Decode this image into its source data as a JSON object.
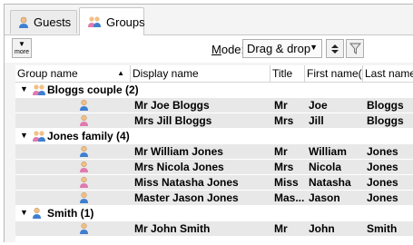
{
  "tabs": [
    {
      "label": "Guests",
      "icon": "person-icon",
      "active": false
    },
    {
      "label": "Groups",
      "icon": "group-icon",
      "active": true
    }
  ],
  "toolbar": {
    "more_label": "more",
    "mode_label_prefix": "M",
    "mode_label_rest": "ode:",
    "mode_value": "Drag & drop"
  },
  "columns": [
    "Group name",
    "Display name",
    "Title",
    "First name(s",
    "Last name("
  ],
  "groups": [
    {
      "label": "Bloggs couple (2)",
      "rows": [
        {
          "display": "Mr Joe Bloggs",
          "title": "Mr",
          "first": "Joe",
          "last": "Bloggs",
          "gender": "male"
        },
        {
          "display": "Mrs Jill Bloggs",
          "title": "Mrs",
          "first": "Jill",
          "last": "Bloggs",
          "gender": "female"
        }
      ]
    },
    {
      "label": "Jones family (4)",
      "rows": [
        {
          "display": "Mr William Jones",
          "title": "Mr",
          "first": "William",
          "last": "Jones",
          "gender": "male"
        },
        {
          "display": "Mrs Nicola Jones",
          "title": "Mrs",
          "first": "Nicola",
          "last": "Jones",
          "gender": "female"
        },
        {
          "display": "Miss Natasha Jones",
          "title": "Miss",
          "first": "Natasha",
          "last": "Jones",
          "gender": "female"
        },
        {
          "display": "Master Jason Jones",
          "title": "Mas...",
          "first": "Jason",
          "last": "Jones",
          "gender": "male"
        }
      ]
    },
    {
      "label": "Smith (1)",
      "rows": [
        {
          "display": "Mr John Smith",
          "title": "Mr",
          "first": "John",
          "last": "Smith",
          "gender": "male"
        }
      ]
    }
  ],
  "colors": {
    "male": "#3f7fd0",
    "female": "#e07ab0",
    "head": "#f0c088",
    "row_bg": "#e8e8e8"
  }
}
